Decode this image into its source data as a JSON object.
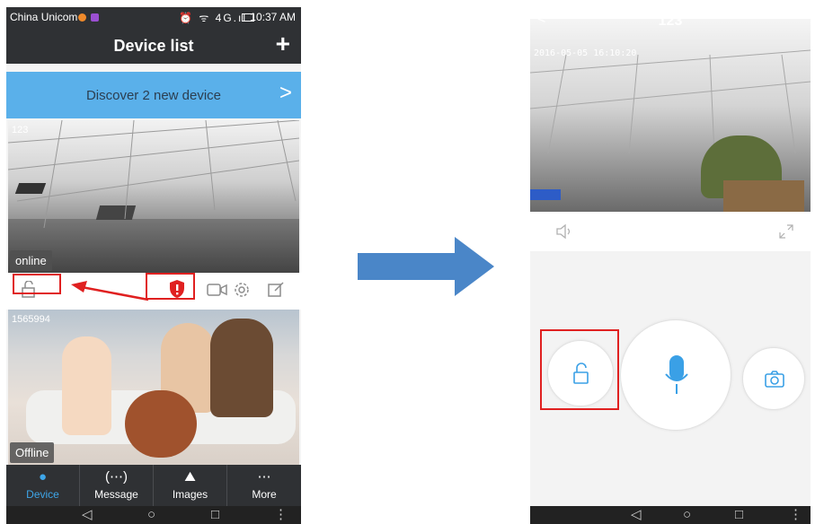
{
  "left": {
    "status": {
      "carrier": "China Unicom",
      "time": "10:37 AM",
      "icons": "⏰ ᯤ 4G.ıl"
    },
    "title": "Device list",
    "add_icon": "+",
    "discover": {
      "text": "Discover  2  new device",
      "chevron": ">"
    },
    "devices": [
      {
        "name": "123",
        "status": "online"
      },
      {
        "name": "1565994",
        "status": "Offline"
      }
    ],
    "tabs": [
      {
        "label": "Device",
        "icon": "person-icon"
      },
      {
        "label": "Message",
        "icon": "chat-bubble-icon"
      },
      {
        "label": "Images",
        "icon": "image-icon"
      },
      {
        "label": "More",
        "icon": "more-icon"
      }
    ],
    "nav": {
      "back": "◁",
      "home": "○",
      "recent": "□",
      "menu": "⋮"
    }
  },
  "right": {
    "title": "123",
    "timestamp": "2016-05-05  16:10:20",
    "nav": {
      "back": "◁",
      "home": "○",
      "recent": "□",
      "menu": "⋮"
    }
  },
  "colors": {
    "accent": "#3ea6e9",
    "banner": "#5ab0ea",
    "highlight": "#e02020",
    "dark": "#2f3134",
    "arrow": "#4a86c8"
  }
}
